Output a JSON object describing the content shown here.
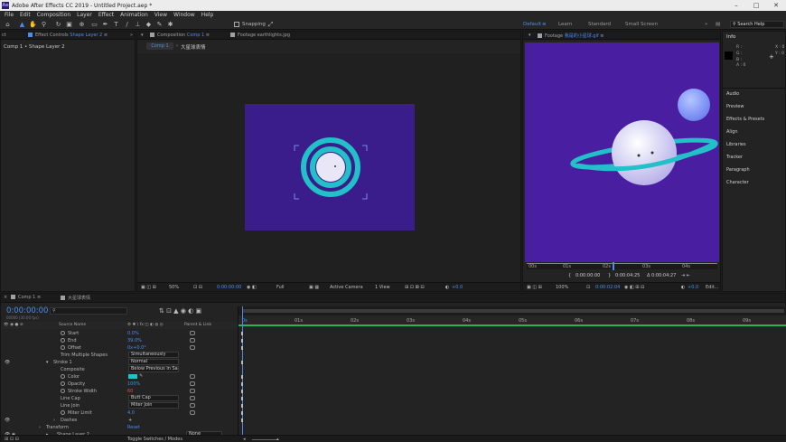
{
  "app": {
    "title": "Adobe After Effects CC 2019 - Untitled Project.aep *",
    "icon_label": "Ae"
  },
  "menu": [
    "File",
    "Edit",
    "Composition",
    "Layer",
    "Effect",
    "Animation",
    "View",
    "Window",
    "Help"
  ],
  "toolbar": {
    "snapping_label": "Snapping",
    "workspaces": [
      "Default",
      "Learn",
      "Standard",
      "Small Screen"
    ],
    "search_placeholder": "Search Help"
  },
  "effect_controls": {
    "tab_label": "Effect Controls",
    "tab_layer": "Shape Layer 2",
    "breadcrumb": "Comp 1 • Shape Layer 2"
  },
  "composition": {
    "tab_label": "Composition",
    "tab_comp": "Comp 1",
    "footage_tab": "Footage earthlights.jpg",
    "subtabs": [
      "Comp 1",
      "大星球表情"
    ],
    "canvas_color": "#3a1d8a",
    "ring_color": "#22c0c8",
    "status": {
      "zoom": "50%",
      "time": "0:00:00:00",
      "resolution": "Full",
      "camera": "Active Camera",
      "view": "1 View",
      "exposure": "+0.0"
    }
  },
  "footage": {
    "tab_label": "Footage",
    "tab_name": "我是的小星球.gif",
    "bg_color": "#4a1ea0",
    "ruler_labels": [
      "00s",
      "01s",
      "02s",
      "03s",
      "04s",
      "05s"
    ],
    "time_in": "0:00:00:00",
    "time_out": "0:00:04:25",
    "duration": "Δ 0:00:04:27",
    "status": {
      "zoom": "100%",
      "time": "0:00:02:04",
      "exposure": "+0.0",
      "edit": "Edit..."
    }
  },
  "right_panel": {
    "info_tab": "Info",
    "info_rgba": [
      "R :",
      "G :",
      "B :",
      "A : 0"
    ],
    "info_xy": [
      "X : 0",
      "Y : 0"
    ],
    "items": [
      "Audio",
      "Preview",
      "Effects & Presets",
      "Align",
      "Libraries",
      "Tracker",
      "Paragraph",
      "Character"
    ]
  },
  "timeline": {
    "tab_label": "Comp 1",
    "tab2_label": "大星球表情",
    "current_time": "0:00:00:00",
    "fps_label": "00000 (30.00 fps)",
    "col_source": "Source Name",
    "col_parent": "Parent & Link",
    "rows": [
      {
        "label": "Start",
        "value": "0.0%",
        "kind": "val"
      },
      {
        "label": "End",
        "value": "39.0%",
        "kind": "val"
      },
      {
        "label": "Offset",
        "value": "0x+0.0°",
        "kind": "val"
      },
      {
        "label": "Trim Multiple Shapes",
        "value": "Simultaneously",
        "kind": "dd"
      },
      {
        "label": "Stroke 1",
        "value": "Normal",
        "kind": "dd"
      },
      {
        "label": "Composite",
        "value": "Below Previous in Sa",
        "kind": "dd"
      },
      {
        "label": "Color",
        "value": "",
        "kind": "color"
      },
      {
        "label": "Opacity",
        "value": "100%",
        "kind": "val"
      },
      {
        "label": "Stroke Width",
        "value": "60",
        "kind": "val"
      },
      {
        "label": "Line Cap",
        "value": "Butt Cap",
        "kind": "dd"
      },
      {
        "label": "Line Join",
        "value": "Miter Join",
        "kind": "dd"
      },
      {
        "label": "Miter Limit",
        "value": "4.0",
        "kind": "val"
      },
      {
        "label": "Dashes",
        "value": "+",
        "kind": "plain"
      },
      {
        "label": "Transform",
        "value": "Reset",
        "kind": "val"
      },
      {
        "label": "Shape Layer 2",
        "value": "None",
        "kind": "dd"
      }
    ],
    "ruler": [
      "0s",
      "01s",
      "02s",
      "03s",
      "04s",
      "05s",
      "06s",
      "07s",
      "08s",
      "09s"
    ],
    "toggle_label": "Toggle Switches / Modes"
  }
}
